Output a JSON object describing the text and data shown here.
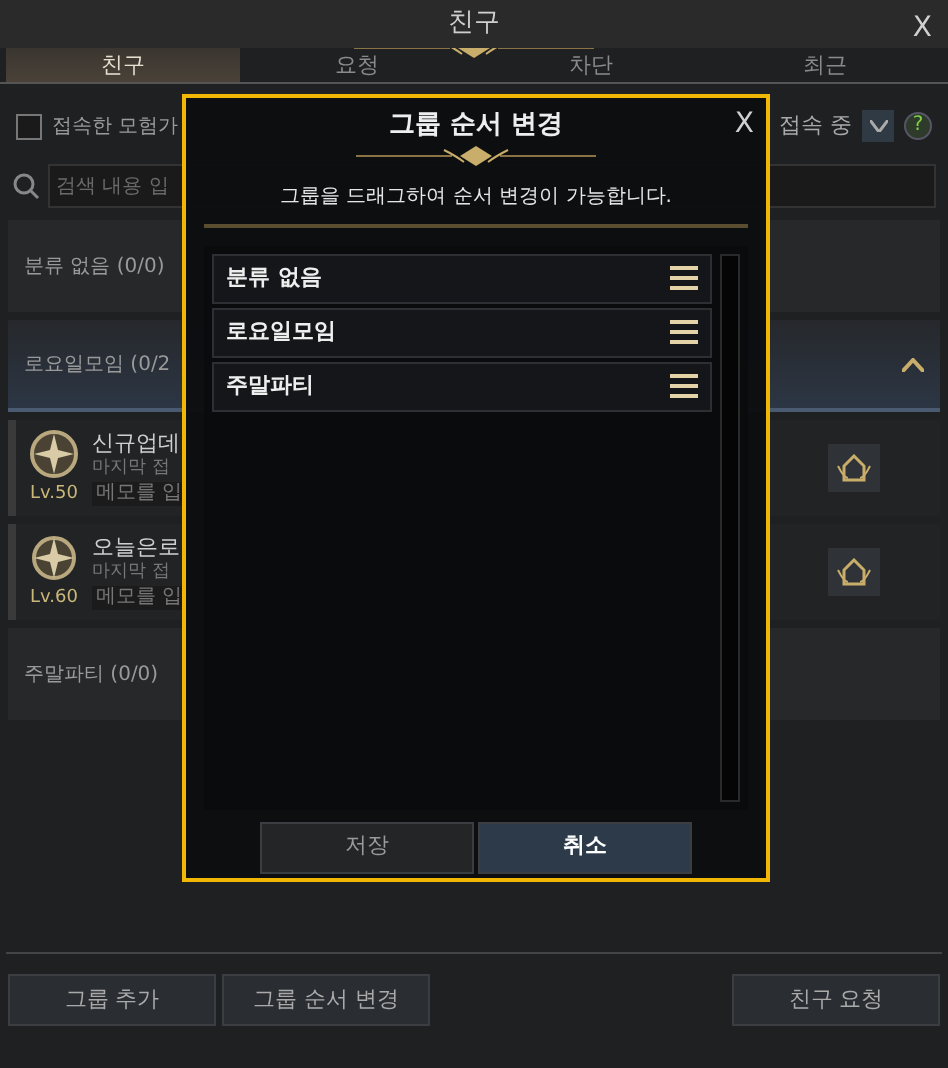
{
  "window": {
    "title": "친구",
    "close": "X"
  },
  "tabs": [
    {
      "label": "친구",
      "selected": true
    },
    {
      "label": "요청",
      "selected": false
    },
    {
      "label": "차단",
      "selected": false
    },
    {
      "label": "최근",
      "selected": false
    }
  ],
  "filter": {
    "label": "접속한 모험가",
    "checked": false
  },
  "status": {
    "label": "접속 중",
    "help": "?"
  },
  "search": {
    "placeholder": "검색 내용 입"
  },
  "groups": [
    {
      "name": "분류 없음 (0/0)",
      "expanded": false
    },
    {
      "name": "로요일모임 (0/2",
      "expanded": true,
      "friends": [
        {
          "name": "신규업데",
          "last_login": "마지막 접",
          "memo": "메모를 입",
          "level": "Lv.50"
        },
        {
          "name": "오늘은로",
          "last_login": "마지막 접",
          "memo": "메모를 입",
          "level": "Lv.60"
        }
      ]
    },
    {
      "name": "주말파티 (0/0)",
      "expanded": false
    }
  ],
  "buttons": [
    {
      "label": "그룹 추가"
    },
    {
      "label": "그룹 순서 변경"
    },
    {
      "label": "친구 요청"
    }
  ],
  "dialog": {
    "title": "그룹 순서 변경",
    "close": "X",
    "instruction": "그룹을 드래그하여 순서 변경이 가능합니다.",
    "items": [
      {
        "label": "분류 없음"
      },
      {
        "label": "로요일모임"
      },
      {
        "label": "주말파티"
      }
    ],
    "buttons": [
      {
        "label": "저장",
        "kind": "normal"
      },
      {
        "label": "취소",
        "kind": "primary"
      }
    ]
  }
}
